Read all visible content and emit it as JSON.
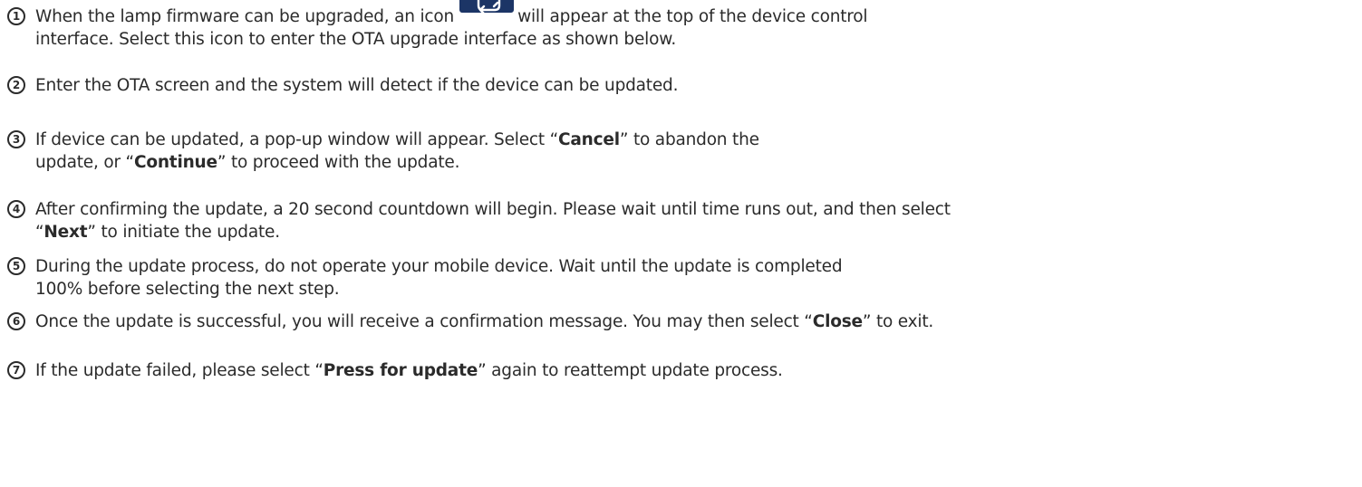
{
  "steps": [
    {
      "number": "1",
      "line1_before_icon": "When the lamp firmware can be upgraded, an icon",
      "icon": "ota-refresh-icon",
      "line1_after_icon": "will appear at the top of the device control",
      "line2": "interface. Select this icon to enter the OTA upgrade interface as shown below."
    },
    {
      "number": "2",
      "line1": "Enter the OTA screen and the system will detect if the device can be updated."
    },
    {
      "number": "3",
      "line1_a": "If device can be updated, a pop-up window will appear. Select “",
      "line1_bold": "Cancel",
      "line1_b": "” to abandon the",
      "line2_a": "update, or “",
      "line2_bold": "Continue",
      "line2_b": "” to proceed with the update."
    },
    {
      "number": "4",
      "line1": "After confirming the update, a 20 second countdown will begin. Please wait until time runs out, and then select",
      "line2_a": "“",
      "line2_bold": "Next",
      "line2_b": "” to initiate the update."
    },
    {
      "number": "5",
      "line1": "During the update process, do not operate your mobile device. Wait until the update is completed",
      "line2": "100% before selecting the next step."
    },
    {
      "number": "6",
      "line1_a": "Once the update is successful, you will receive a confirmation message. You may then select “",
      "line1_bold": "Close",
      "line1_b": "” to exit."
    },
    {
      "number": "7",
      "line1_a": "If the update failed, please select “",
      "line1_bold": "Press for update",
      "line1_b": "” again to reattempt update process."
    }
  ],
  "colors": {
    "text": "#2b2b2b",
    "icon_background": "#1c3566",
    "icon_foreground": "#ffffff"
  }
}
